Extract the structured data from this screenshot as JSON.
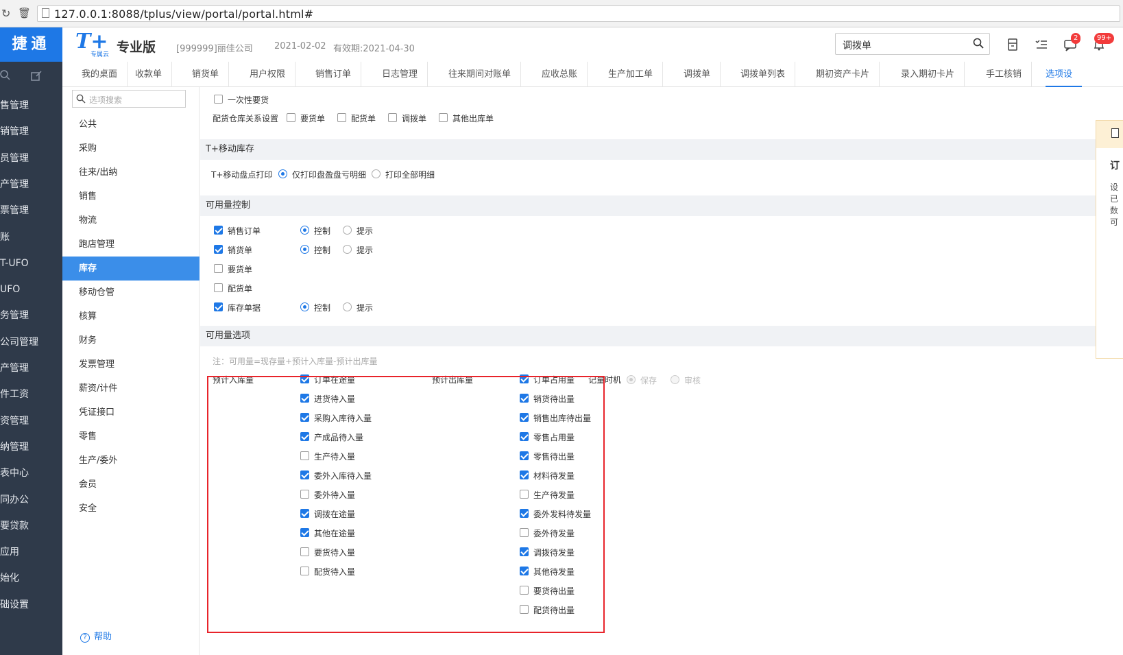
{
  "browser": {
    "url": "127.0.0.1:8088/tplus/view/portal/portal.html#"
  },
  "header": {
    "brand": "捷通",
    "logo": "T+",
    "logo_sub": "专属云",
    "edition": "专业版",
    "company": "[999999]丽佳公司",
    "date": "2021-02-02",
    "validity": "有效期:2021-04-30",
    "search_value": "调拨单",
    "msg_badge": "2",
    "notify_badge": "99+"
  },
  "left_nav": [
    "售管理",
    "销管理",
    "员管理",
    "产管理",
    "票管理",
    "账",
    "T-UFO",
    "UFO",
    "务管理",
    "公司管理",
    "产管理",
    "件工资",
    "资管理",
    "纳管理",
    "表中心",
    "同办公",
    "要贷款",
    "应用",
    "始化",
    "础设置"
  ],
  "tabs": [
    "我的桌面",
    "收款单",
    "销货单",
    "用户权限",
    "销售订单",
    "日志管理",
    "往来期间对账单",
    "应收总账",
    "生产加工单",
    "调拨单",
    "调拨单列表",
    "期初资产卡片",
    "录入期初卡片",
    "手工核销",
    "选项设"
  ],
  "options_sidebar": {
    "search_placeholder": "选项搜索",
    "items": [
      "公共",
      "采购",
      "往来/出纳",
      "销售",
      "物流",
      "跑店管理",
      "库存",
      "移动仓管",
      "核算",
      "财务",
      "发票管理",
      "薪资/计件",
      "凭证接口",
      "零售",
      "生产/委外",
      "会员",
      "安全"
    ],
    "active": "库存",
    "help": "帮助"
  },
  "main": {
    "top": {
      "one_time": "一次性要货",
      "relation_label": "配货仓库关系设置",
      "relation_opts": [
        "要货单",
        "配货单",
        "调拨单",
        "其他出库单"
      ]
    },
    "mobile": {
      "head": "T+移动库存",
      "label": "T+移动盘点打印",
      "opt1": "仅打印盘盈盘亏明细",
      "opt2": "打印全部明细"
    },
    "avail_ctrl": {
      "head": "可用量控制",
      "rows": [
        {
          "label": "销售订单",
          "checked": true,
          "radios": true
        },
        {
          "label": "销货单",
          "checked": true,
          "radios": true
        },
        {
          "label": "要货单",
          "checked": false,
          "radios": false
        },
        {
          "label": "配货单",
          "checked": false,
          "radios": false
        },
        {
          "label": "库存单据",
          "checked": true,
          "radios": true
        }
      ],
      "ctrl": "控制",
      "hint": "提示"
    },
    "avail_opts": {
      "head": "可用量选项",
      "note": "注：可用量=现存量+预计入库量-预计出库量",
      "in_label": "预计入库量",
      "in_items": [
        {
          "label": "订单在途量",
          "checked": true
        },
        {
          "label": "进货待入量",
          "checked": true
        },
        {
          "label": "采购入库待入量",
          "checked": true
        },
        {
          "label": "产成品待入量",
          "checked": true
        },
        {
          "label": "生产待入量",
          "checked": false
        },
        {
          "label": "委外入库待入量",
          "checked": true
        },
        {
          "label": "委外待入量",
          "checked": false
        },
        {
          "label": "调拨在途量",
          "checked": true
        },
        {
          "label": "其他在途量",
          "checked": true
        },
        {
          "label": "要货待入量",
          "checked": false
        },
        {
          "label": "配货待入量",
          "checked": false
        }
      ],
      "out_label": "预计出库量",
      "out_items": [
        {
          "label": "订单占用量",
          "checked": true
        },
        {
          "label": "销货待出量",
          "checked": true
        },
        {
          "label": "销售出库待出量",
          "checked": true
        },
        {
          "label": "零售占用量",
          "checked": true
        },
        {
          "label": "零售待出量",
          "checked": true
        },
        {
          "label": "材料待发量",
          "checked": true
        },
        {
          "label": "生产待发量",
          "checked": false
        },
        {
          "label": "委外发料待发量",
          "checked": true
        },
        {
          "label": "委外待发量",
          "checked": false
        },
        {
          "label": "调拨待发量",
          "checked": true
        },
        {
          "label": "其他待发量",
          "checked": true
        },
        {
          "label": "要货待出量",
          "checked": false
        },
        {
          "label": "配货待出量",
          "checked": false
        }
      ],
      "timing_label": "记量时机",
      "timing_opt1": "保存",
      "timing_opt2": "审核"
    }
  },
  "float_panel": {
    "title": "订",
    "lines": [
      "设",
      "已",
      "数",
      "可"
    ]
  }
}
